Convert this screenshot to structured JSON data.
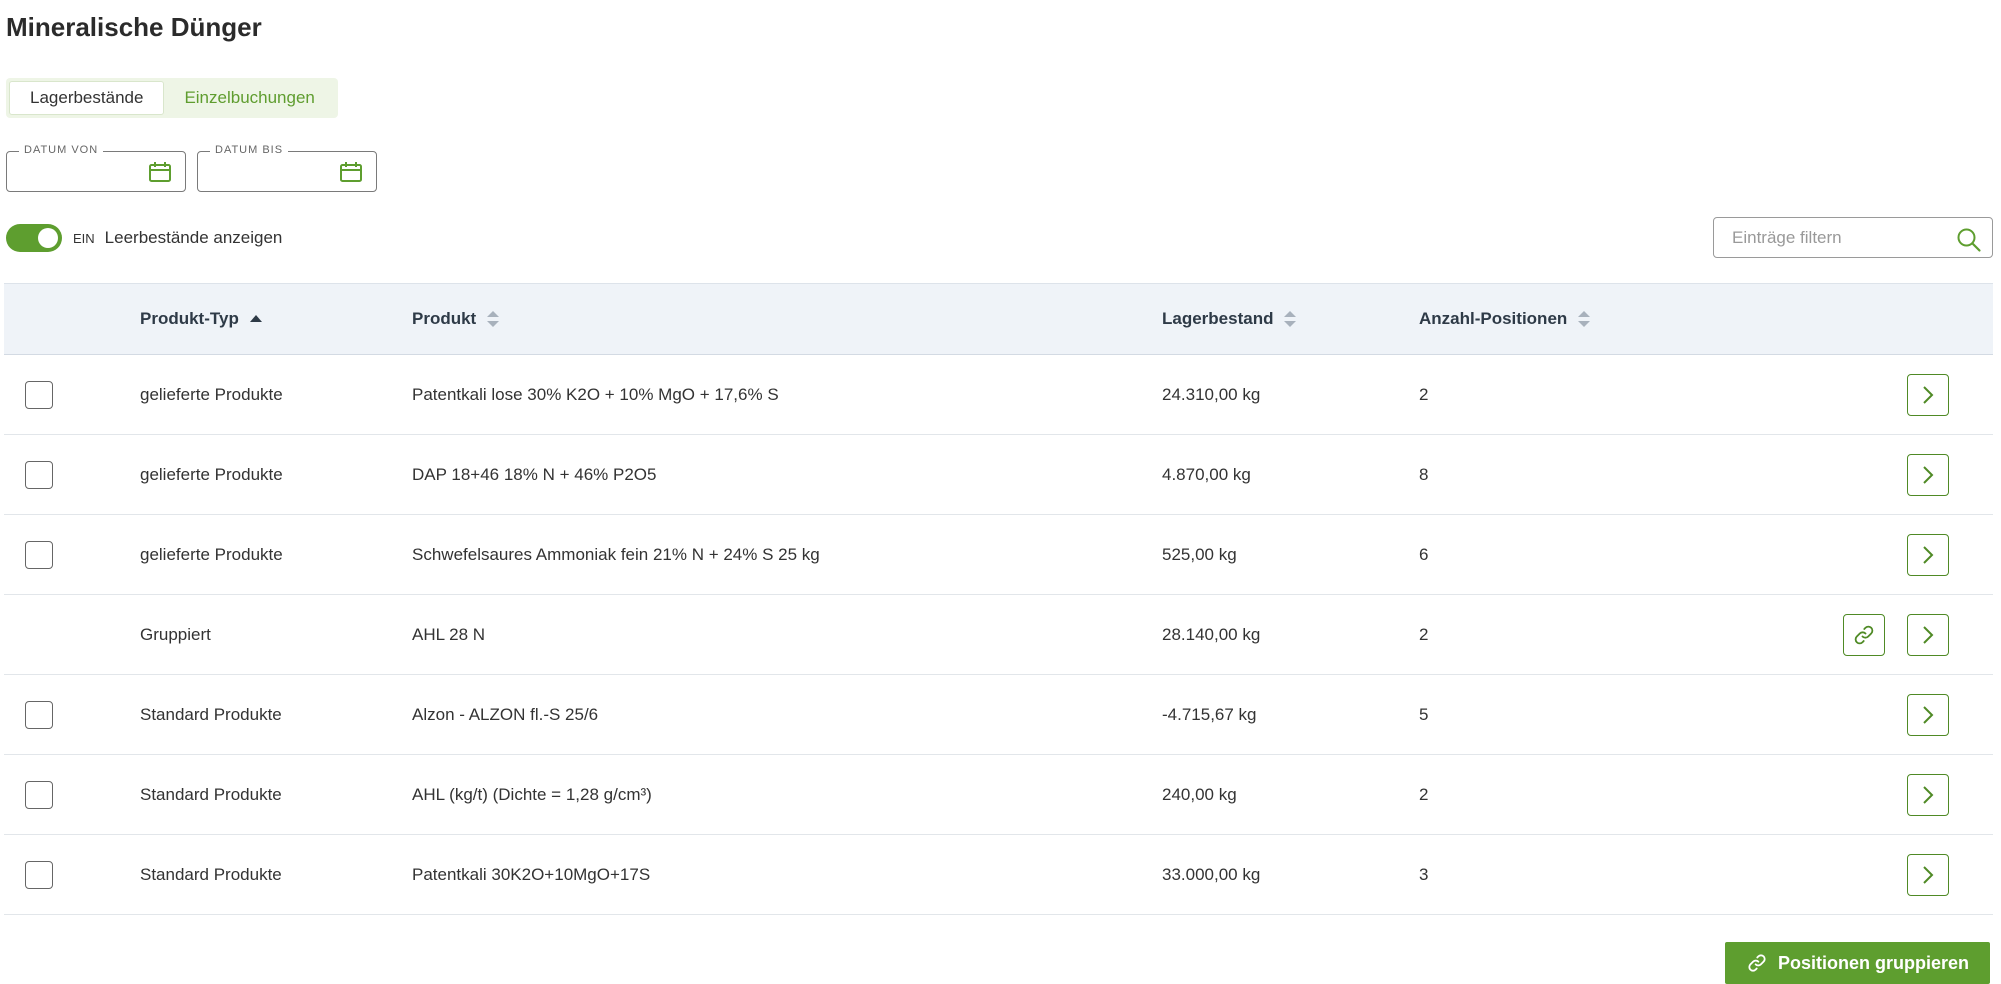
{
  "page": {
    "title": "Mineralische Dünger"
  },
  "tabs": [
    {
      "label": "Lagerbestände",
      "active": true
    },
    {
      "label": "Einzelbuchungen",
      "active": false
    }
  ],
  "date_filters": {
    "from": {
      "label": "DATUM VON",
      "value": "",
      "icon": "calendar-icon"
    },
    "to": {
      "label": "DATUM BIS",
      "value": "",
      "icon": "calendar-icon"
    }
  },
  "toggle": {
    "state": "EIN",
    "label": "Leerbestände anzeigen",
    "on": true
  },
  "filter": {
    "placeholder": "Einträge filtern",
    "value": "",
    "icon": "search-icon"
  },
  "table": {
    "columns": [
      {
        "label": "Produkt-Typ",
        "sort": "asc"
      },
      {
        "label": "Produkt",
        "sort": "none"
      },
      {
        "label": "Lagerbestand",
        "sort": "none"
      },
      {
        "label": "Anzahl-Positionen",
        "sort": "none"
      }
    ],
    "rows": [
      {
        "type": "gelieferte Produkte",
        "product": "Patentkali lose 30% K2O + 10% MgO + 17,6% S",
        "stock": "24.310,00 kg",
        "count": "2",
        "selectable": true,
        "grouped": false
      },
      {
        "type": "gelieferte Produkte",
        "product": "DAP 18+46 18% N + 46% P2O5",
        "stock": "4.870,00 kg",
        "count": "8",
        "selectable": true,
        "grouped": false
      },
      {
        "type": "gelieferte Produkte",
        "product": "Schwefelsaures Ammoniak fein 21% N + 24% S 25 kg",
        "stock": "525,00 kg",
        "count": "6",
        "selectable": true,
        "grouped": false
      },
      {
        "type": "Gruppiert",
        "product": "AHL 28 N",
        "stock": "28.140,00 kg",
        "count": "2",
        "selectable": false,
        "grouped": true
      },
      {
        "type": "Standard Produkte",
        "product": "Alzon - ALZON fl.-S 25/6",
        "stock": "-4.715,67 kg",
        "count": "5",
        "selectable": true,
        "grouped": false
      },
      {
        "type": "Standard Produkte",
        "product": "AHL (kg/t) (Dichte = 1,28 g/cm³)",
        "stock": "240,00 kg",
        "count": "2",
        "selectable": true,
        "grouped": false
      },
      {
        "type": "Standard Produkte",
        "product": "Patentkali 30K2O+10MgO+17S",
        "stock": "33.000,00 kg",
        "count": "3",
        "selectable": true,
        "grouped": false
      }
    ]
  },
  "actions": {
    "group_label": "Positionen gruppieren",
    "group_icon": "link-icon"
  },
  "colors": {
    "accent": "#5e9e2f",
    "header_bg": "#eff3f8",
    "tab_bg": "#eef5e6"
  }
}
